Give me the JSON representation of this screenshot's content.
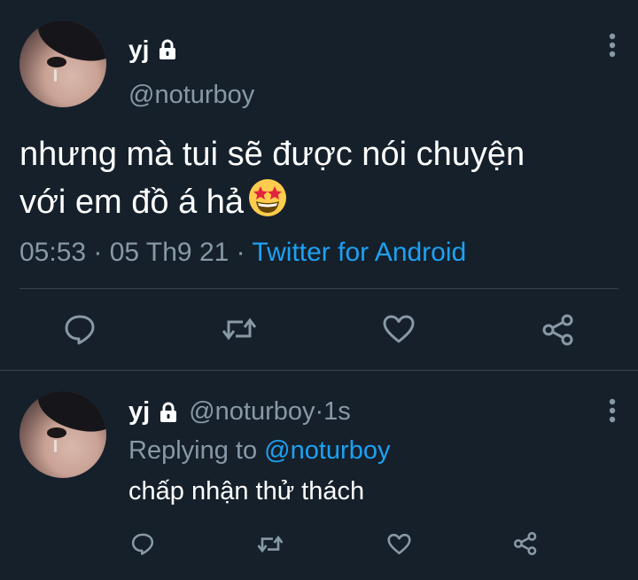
{
  "main_tweet": {
    "display_name": "yj",
    "handle": "@noturboy",
    "text_line1": "nhưng mà tui sẽ được nói chuyện",
    "text_line2": "với em đồ á hả",
    "emoji": "star-struck",
    "time": "05:53",
    "date": "05 Th9 21",
    "source": "Twitter for Android",
    "separator": " · ",
    "actions": [
      "reply",
      "retweet",
      "like",
      "share"
    ]
  },
  "reply_tweet": {
    "display_name": "yj",
    "handle": "@noturboy",
    "time_ago": "1s",
    "separator": " · ",
    "replying_label": "Replying to",
    "replying_to": "@noturboy",
    "text": "chấp nhận thử thách",
    "actions": [
      "reply",
      "retweet",
      "like",
      "share"
    ]
  },
  "colors": {
    "background": "#15202b",
    "secondary_text": "#8899a6",
    "link": "#1da1f2",
    "border": "#38444d"
  }
}
